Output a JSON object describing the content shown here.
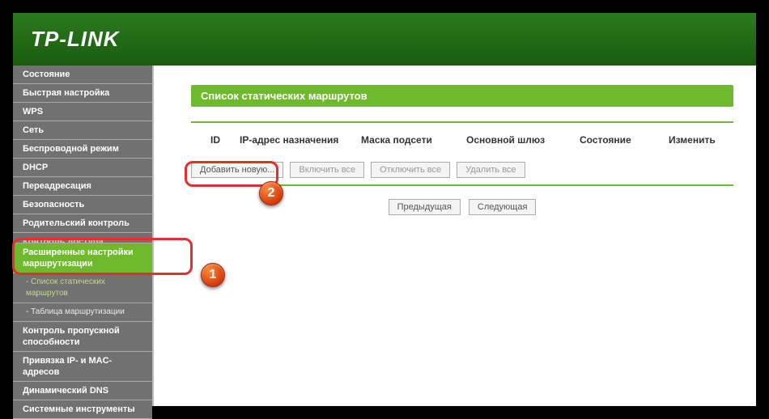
{
  "brand": "TP-LINK",
  "sidebar": {
    "items": [
      {
        "label": "Состояние"
      },
      {
        "label": "Быстрая настройка"
      },
      {
        "label": "WPS"
      },
      {
        "label": "Сеть"
      },
      {
        "label": "Беспроводной режим"
      },
      {
        "label": "DHCP"
      },
      {
        "label": "Переадресация"
      },
      {
        "label": "Безопасность"
      },
      {
        "label": "Родительский контроль"
      },
      {
        "label": "Контроль доступа",
        "truncated": true
      }
    ],
    "active_group": "Расширенные настройки маршрутизации",
    "sub_items": [
      {
        "label": "- Список статических маршрутов",
        "selected": true
      },
      {
        "label": "- Таблица маршрутизации"
      }
    ],
    "after_items": [
      {
        "label": "Контроль пропускной способности"
      },
      {
        "label": "Привязка IP- и MAC-адресов"
      },
      {
        "label": "Динамический DNS"
      },
      {
        "label": "Системные инструменты"
      }
    ]
  },
  "page": {
    "title": "Список статических маршрутов",
    "columns": {
      "id": "ID",
      "ip": "IP-адрес назначения",
      "mask": "Маска подсети",
      "gw": "Основной шлюз",
      "state": "Состояние",
      "edit": "Изменить"
    },
    "buttons": {
      "add": "Добавить новую...",
      "enable_all": "Включить все",
      "disable_all": "Отключить все",
      "delete_all": "Удалить все"
    },
    "pager": {
      "prev": "Предыдущая",
      "next": "Следующая"
    }
  },
  "markers": {
    "one": "1",
    "two": "2"
  }
}
